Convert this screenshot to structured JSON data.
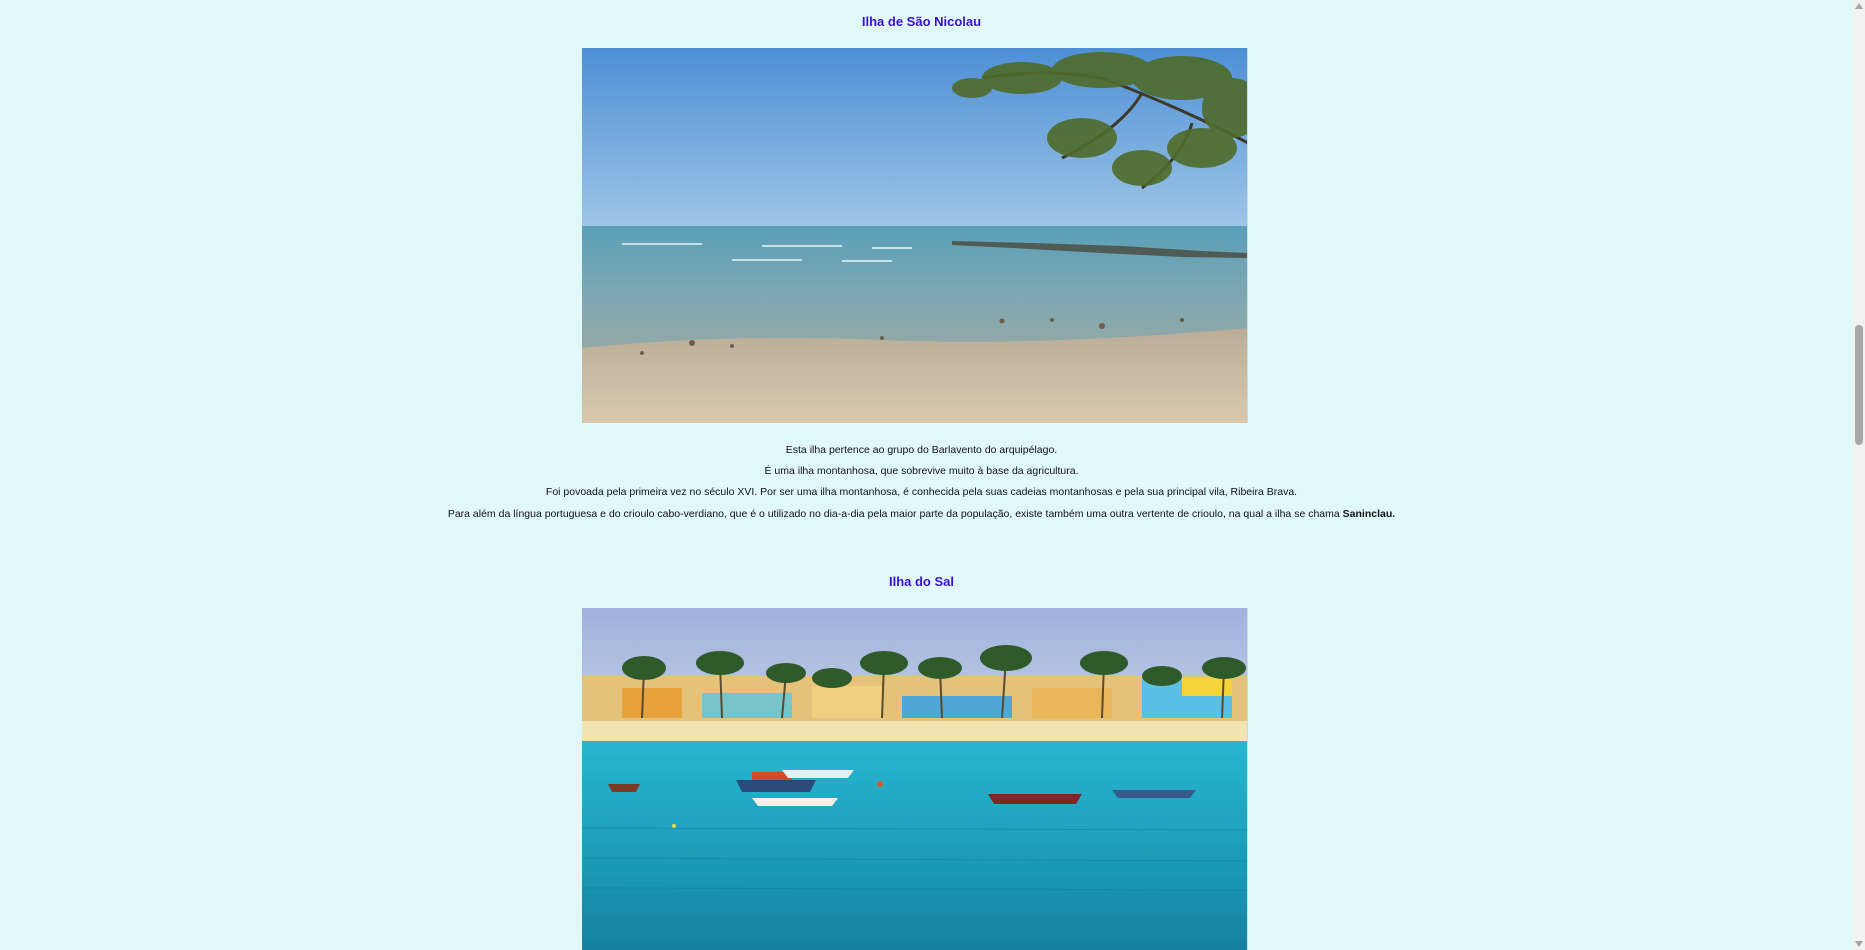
{
  "sections": [
    {
      "title": "Ilha de São Nicolau",
      "image_alt": "Praia da Ilha de São Nicolau",
      "paragraphs": [
        "Esta ilha pertence ao grupo do Barlavento do arquipélago.",
        "É uma ilha montanhosa, que sobrevive muito à base da agricultura.",
        "Foi povoada pela primeira vez no século XVI. Por ser uma ilha montanhosa, é conhecida pela suas cadeias montanhosas e pela sua principal vila, Ribeira Brava."
      ],
      "last_paragraph_text": "Para além da língua portuguesa e do crioulo cabo-verdiano, que é o utilizado no dia-a-dia pela maior parte da população, existe também uma outra vertente de crioulo, na qual a ilha se chama ",
      "last_paragraph_bold": "Saninclau."
    },
    {
      "title": "Ilha do Sal",
      "image_alt": "Praia com barcos na Ilha do Sal"
    }
  ],
  "colors": {
    "background": "#e0f9f8",
    "title": "#3a10d8"
  },
  "icons": {
    "scroll_up": "triangle-up-icon",
    "scroll_down": "triangle-down-icon"
  }
}
